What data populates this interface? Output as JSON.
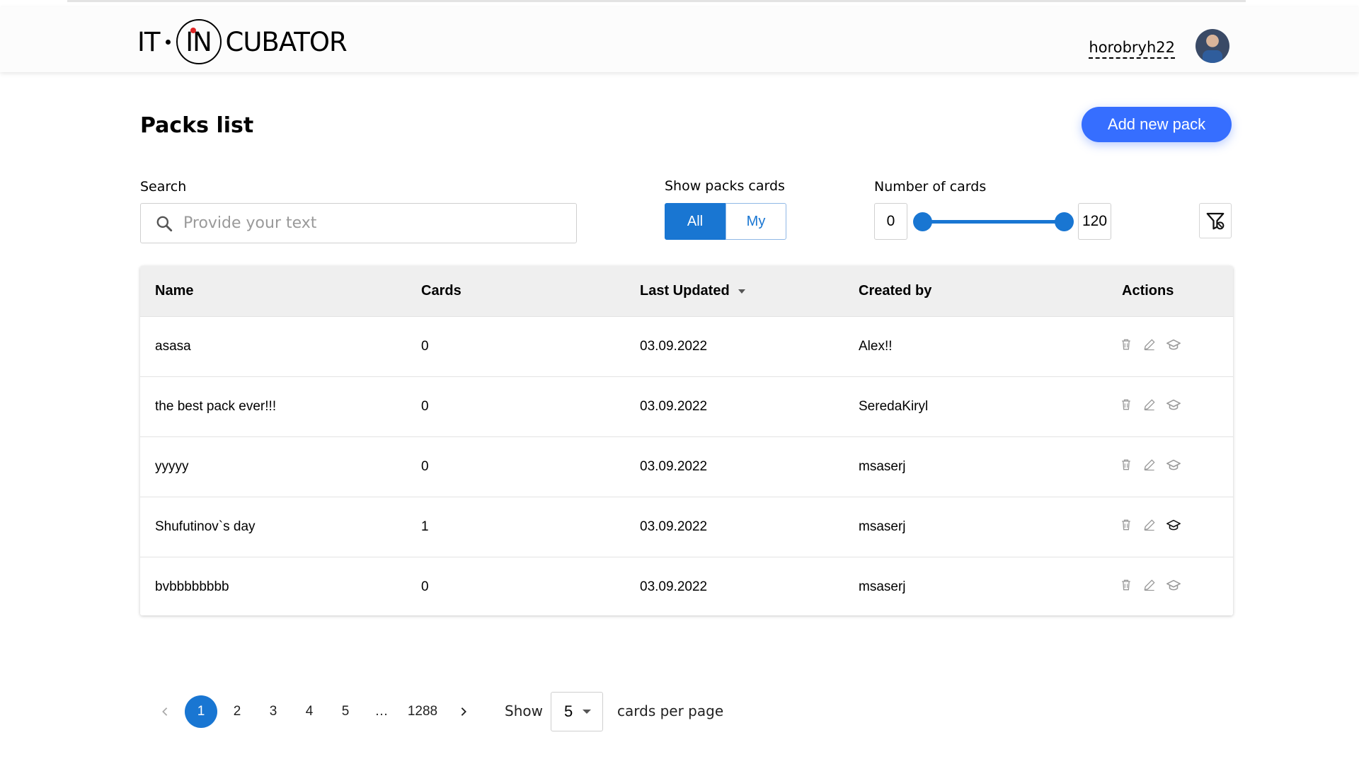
{
  "header": {
    "logo": {
      "part1": "IT",
      "part2": "IN",
      "part3": "CUBATOR"
    },
    "user_name": "horobryh22"
  },
  "page": {
    "title": "Packs list",
    "add_button_label": "Add new pack"
  },
  "filters": {
    "search_label": "Search",
    "search_placeholder": "Provide your text",
    "search_value": "",
    "show_label": "Show packs cards",
    "show_all": "All",
    "show_my": "My",
    "show_selected": "All",
    "count_label": "Number of cards",
    "range_min": "0",
    "range_max": "120"
  },
  "table": {
    "headers": {
      "name": "Name",
      "cards": "Cards",
      "updated": "Last Updated",
      "created_by": "Created by",
      "actions": "Actions"
    },
    "sort_column": "Last Updated",
    "rows": [
      {
        "name": "asasa",
        "cards": "0",
        "updated": "03.09.2022",
        "created_by": "Alex!!"
      },
      {
        "name": "the best pack ever!!!",
        "cards": "0",
        "updated": "03.09.2022",
        "created_by": "SeredaKiryl"
      },
      {
        "name": "yyyyy",
        "cards": "0",
        "updated": "03.09.2022",
        "created_by": "msaserj"
      },
      {
        "name": "Shufutinov`s day",
        "cards": "1",
        "updated": "03.09.2022",
        "created_by": "msaserj"
      },
      {
        "name": "bvbbbbbbbb",
        "cards": "0",
        "updated": "03.09.2022",
        "created_by": "msaserj"
      }
    ]
  },
  "pagination": {
    "pages": [
      "1",
      "2",
      "3",
      "4",
      "5",
      "…",
      "1288"
    ],
    "current": "1",
    "show_label": "Show",
    "per_page": "5",
    "per_page_label": "cards per page"
  },
  "colors": {
    "primary": "#1976d2",
    "add_button": "#366eff",
    "header_bg": "#efefef"
  },
  "icons": [
    "search-icon",
    "filter-off-icon",
    "trash-icon",
    "edit-icon",
    "learn-cap-icon",
    "chevron-left-icon",
    "chevron-right-icon",
    "caret-down-icon"
  ]
}
